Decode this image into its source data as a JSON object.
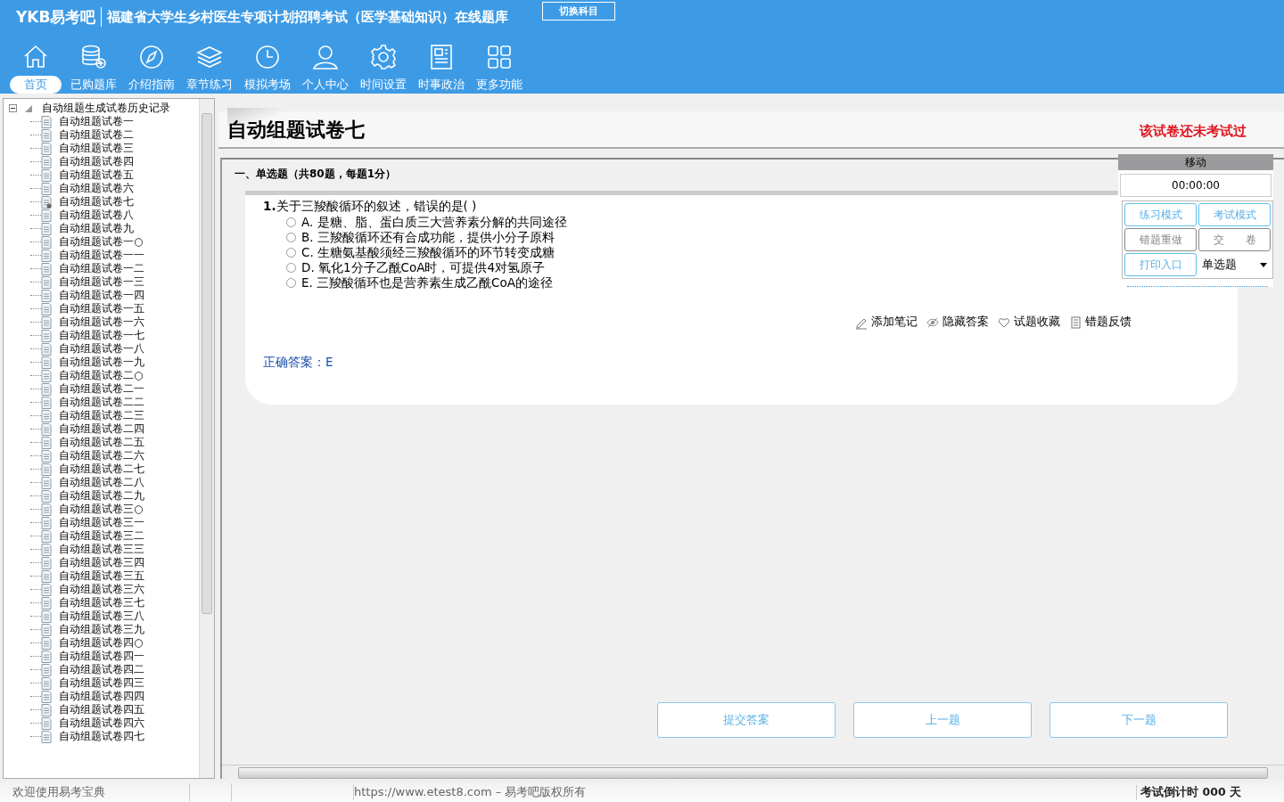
{
  "header": {
    "logo": "YKB易考吧",
    "title": "福建省大学生乡村医生专项计划招聘考试（医学基础知识）在线题库",
    "switch_button": "切换科目"
  },
  "toolbar": [
    {
      "label": "首页",
      "selected": true
    },
    {
      "label": "已购题库",
      "selected": false
    },
    {
      "label": "介绍指南",
      "selected": false
    },
    {
      "label": "章节练习",
      "selected": false
    },
    {
      "label": "模拟考场",
      "selected": false
    },
    {
      "label": "个人中心",
      "selected": false
    },
    {
      "label": "时间设置",
      "selected": false
    },
    {
      "label": "时事政治",
      "selected": false
    },
    {
      "label": "更多功能",
      "selected": false
    }
  ],
  "tree": {
    "label": "自动组题生成试卷历史记录",
    "expanded": true,
    "children": [
      {
        "label": "自动组题试卷一",
        "selected": false
      },
      {
        "label": "自动组题试卷二",
        "selected": false
      },
      {
        "label": "自动组题试卷三",
        "selected": false
      },
      {
        "label": "自动组题试卷四",
        "selected": false
      },
      {
        "label": "自动组题试卷五",
        "selected": false
      },
      {
        "label": "自动组题试卷六",
        "selected": false
      },
      {
        "label": "自动组题试卷七",
        "selected": true
      },
      {
        "label": "自动组题试卷八",
        "selected": false
      },
      {
        "label": "自动组题试卷九",
        "selected": false
      },
      {
        "label": "自动组题试卷一○",
        "selected": false
      },
      {
        "label": "自动组题试卷一一",
        "selected": false
      },
      {
        "label": "自动组题试卷一二",
        "selected": false
      },
      {
        "label": "自动组题试卷一三",
        "selected": false
      },
      {
        "label": "自动组题试卷一四",
        "selected": false
      },
      {
        "label": "自动组题试卷一五",
        "selected": false
      },
      {
        "label": "自动组题试卷一六",
        "selected": false
      },
      {
        "label": "自动组题试卷一七",
        "selected": false
      },
      {
        "label": "自动组题试卷一八",
        "selected": false
      },
      {
        "label": "自动组题试卷一九",
        "selected": false
      },
      {
        "label": "自动组题试卷二○",
        "selected": false
      },
      {
        "label": "自动组题试卷二一",
        "selected": false
      },
      {
        "label": "自动组题试卷二二",
        "selected": false
      },
      {
        "label": "自动组题试卷二三",
        "selected": false
      },
      {
        "label": "自动组题试卷二四",
        "selected": false
      },
      {
        "label": "自动组题试卷二五",
        "selected": false
      },
      {
        "label": "自动组题试卷二六",
        "selected": false
      },
      {
        "label": "自动组题试卷二七",
        "selected": false
      },
      {
        "label": "自动组题试卷二八",
        "selected": false
      },
      {
        "label": "自动组题试卷二九",
        "selected": false
      },
      {
        "label": "自动组题试卷三○",
        "selected": false
      },
      {
        "label": "自动组题试卷三一",
        "selected": false
      },
      {
        "label": "自动组题试卷三二",
        "selected": false
      },
      {
        "label": "自动组题试卷三三",
        "selected": false
      },
      {
        "label": "自动组题试卷三四",
        "selected": false
      },
      {
        "label": "自动组题试卷三五",
        "selected": false
      },
      {
        "label": "自动组题试卷三六",
        "selected": false
      },
      {
        "label": "自动组题试卷三七",
        "selected": false
      },
      {
        "label": "自动组题试卷三八",
        "selected": false
      },
      {
        "label": "自动组题试卷三九",
        "selected": false
      },
      {
        "label": "自动组题试卷四○",
        "selected": false
      },
      {
        "label": "自动组题试卷四一",
        "selected": false
      },
      {
        "label": "自动组题试卷四二",
        "selected": false
      },
      {
        "label": "自动组题试卷四三",
        "selected": false
      },
      {
        "label": "自动组题试卷四四",
        "selected": false
      },
      {
        "label": "自动组题试卷四五",
        "selected": false
      },
      {
        "label": "自动组题试卷四六",
        "selected": false
      },
      {
        "label": "自动组题试卷四七",
        "selected": false
      }
    ]
  },
  "paper": {
    "title": "自动组题试卷七",
    "status": "该试卷还未考试过",
    "section": "一、单选题（共80题，每题1分）",
    "question": {
      "number": "1.",
      "text": "关于三羧酸循环的叙述，错误的是( )",
      "options": [
        {
          "letter": "A.",
          "text": "是糖、脂、蛋白质三大营养素分解的共同途径",
          "selected": false
        },
        {
          "letter": "B.",
          "text": "三羧酸循环还有合成功能，提供小分子原料",
          "selected": false
        },
        {
          "letter": "C.",
          "text": "生糖氨基酸须经三羧酸循环的环节转变成糖",
          "selected": false
        },
        {
          "letter": "D.",
          "text": "氧化1分子乙酰CoA时，可提供4对氢原子",
          "selected": false
        },
        {
          "letter": "E.",
          "text": "三羧酸循环也是营养素生成乙酰CoA的途径",
          "selected": false
        }
      ]
    },
    "actions": [
      "添加笔记",
      "隐藏答案",
      "试题收藏",
      "错题反馈"
    ],
    "answer": "正确答案：E",
    "nav_buttons": [
      "提交答案",
      "上一题",
      "下一题"
    ]
  },
  "side_panel": {
    "header": "移动",
    "timer": "00:00:00",
    "buttons": [
      {
        "label": "练习模式",
        "kind": "accent"
      },
      {
        "label": "考试模式",
        "kind": "accent"
      },
      {
        "label": "错题重做",
        "kind": "plain"
      },
      {
        "label": "交　　卷",
        "kind": "plain"
      },
      {
        "label": "打印入口",
        "kind": "accent"
      }
    ],
    "type_select": "单选题"
  },
  "status_bar": {
    "welcome": "欢迎使用易考宝典",
    "copyright": "https://www.etest8.com – 易考吧版权所有",
    "countdown": "考试倒计时 000 天"
  }
}
